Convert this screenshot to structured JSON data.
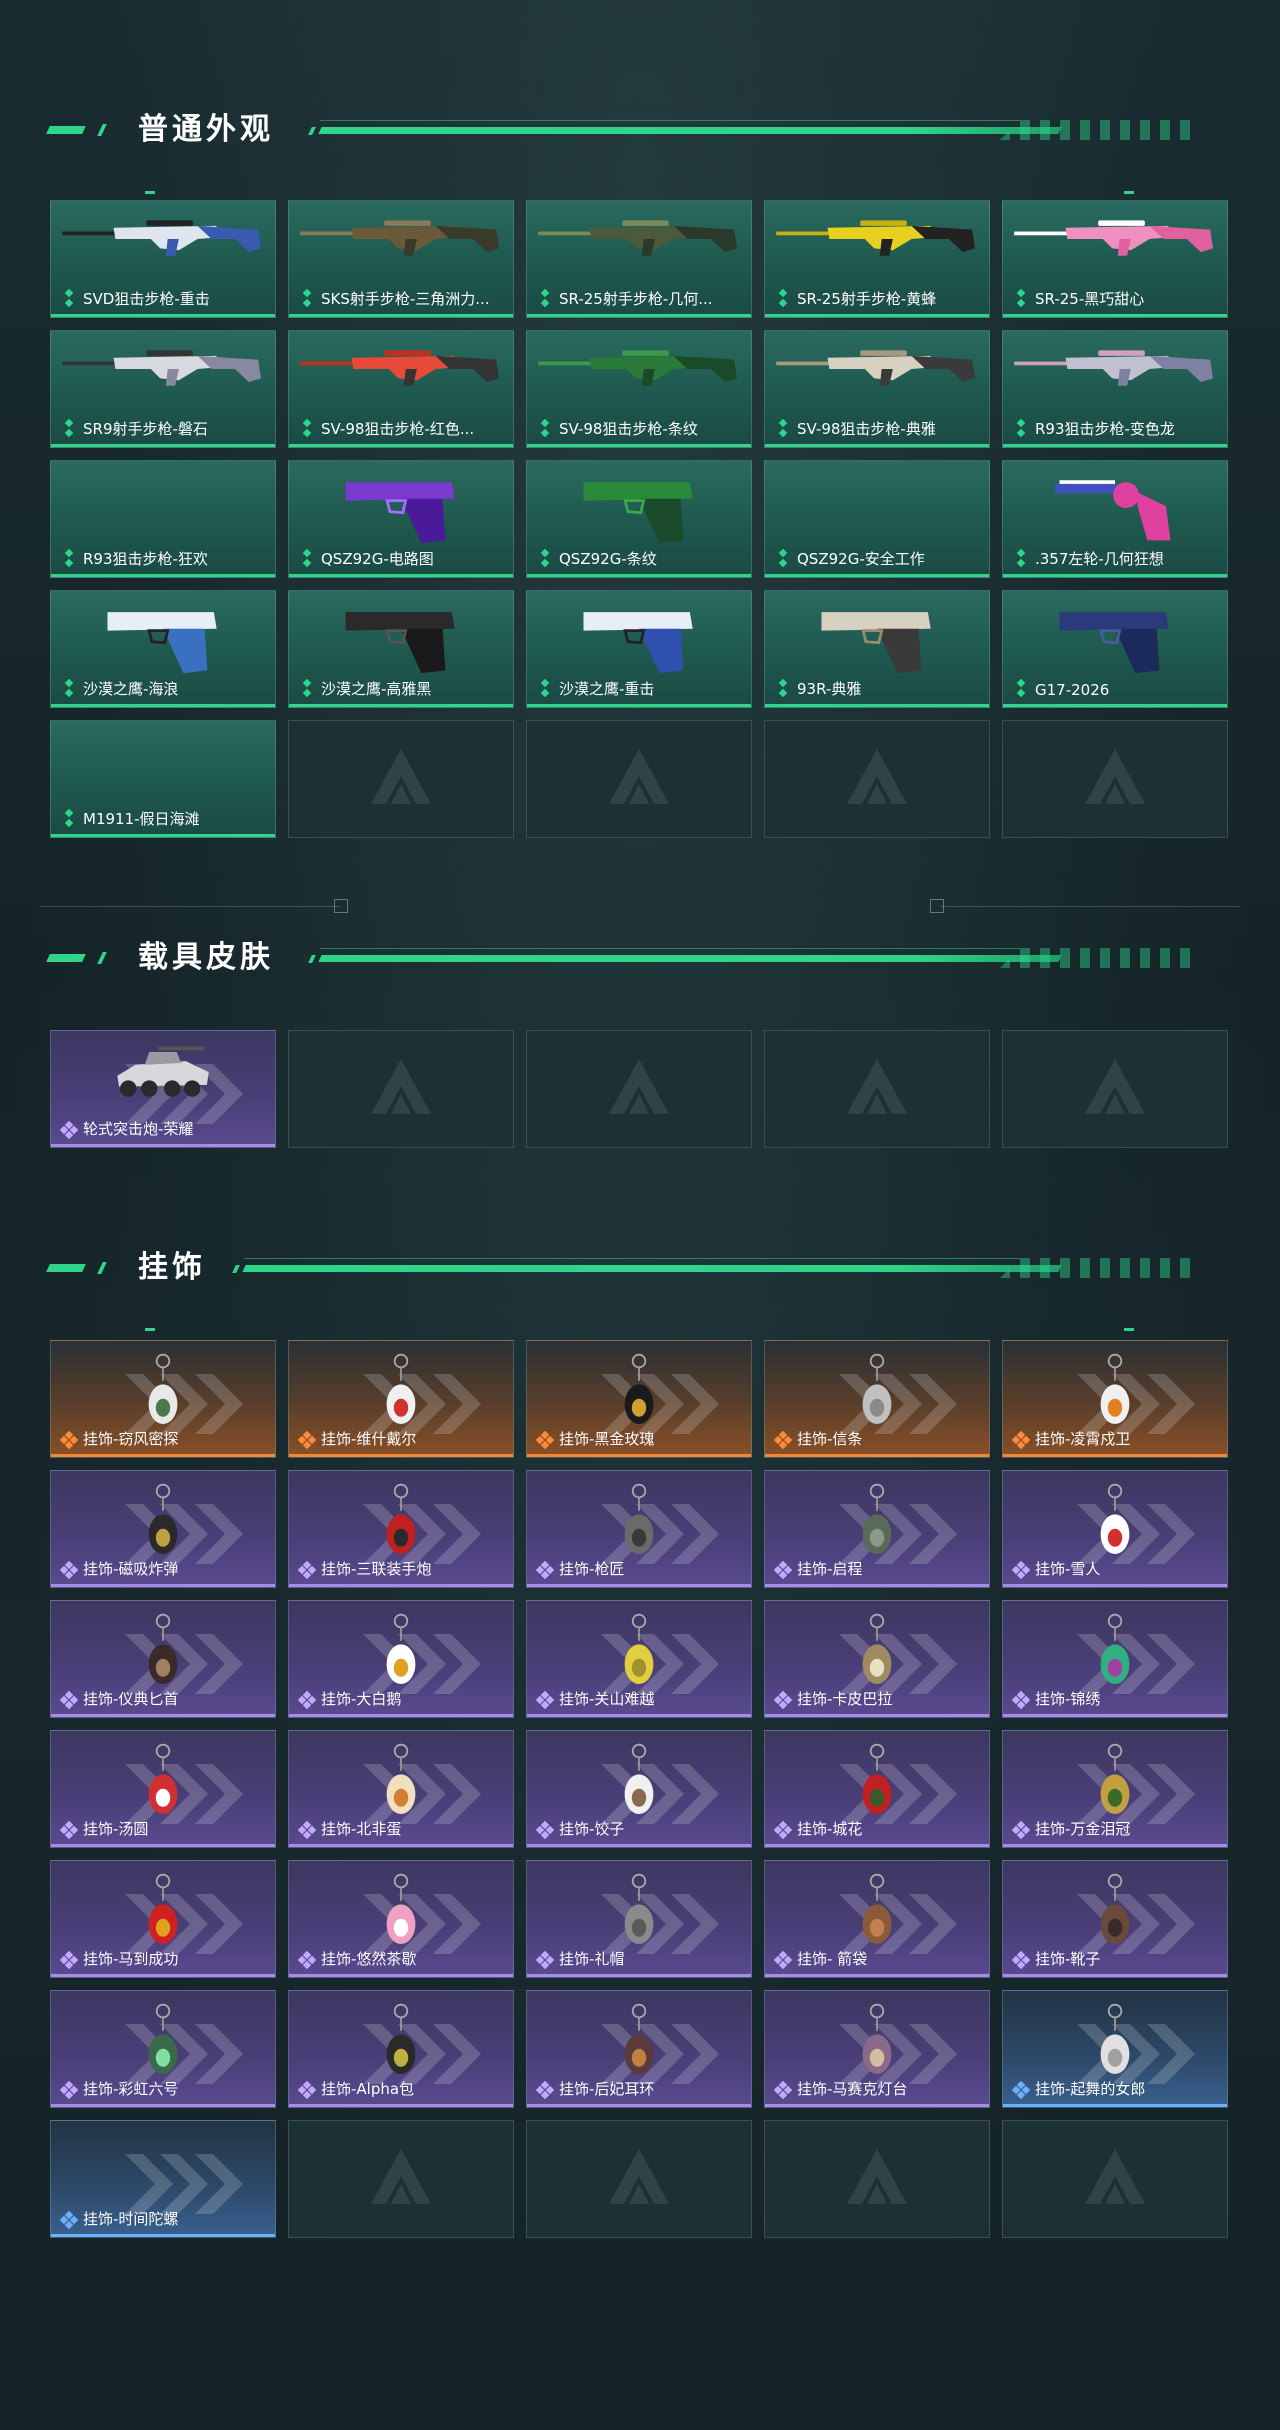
{
  "sections": {
    "appearance": {
      "title": "普通外观",
      "items": [
        {
          "label": "SVD狙击步枪-重击",
          "kind": "rifle",
          "colors": [
            "#dfe4ee",
            "#3a5ab0",
            "#222"
          ]
        },
        {
          "label": "SKS射手步枪-三角洲力...",
          "kind": "rifle",
          "colors": [
            "#6a5a3a",
            "#3a3a2a",
            "#8a7a5a"
          ]
        },
        {
          "label": "SR-25射手步枪-几何...",
          "kind": "rifle",
          "colors": [
            "#4a5a3a",
            "#2a3a2a",
            "#7a8a5a"
          ]
        },
        {
          "label": "SR-25射手步枪-黄蜂",
          "kind": "rifle",
          "colors": [
            "#e8d020",
            "#222",
            "#c8b010"
          ]
        },
        {
          "label": "SR-25-黑巧甜心",
          "kind": "rifle",
          "colors": [
            "#f090c0",
            "#e060a0",
            "#fff"
          ]
        },
        {
          "label": "SR9射手步枪-磐石",
          "kind": "rifle",
          "colors": [
            "#d8d8e0",
            "#8888a0",
            "#333"
          ]
        },
        {
          "label": "SV-98狙击步枪-红色...",
          "kind": "rifle",
          "colors": [
            "#e84a3a",
            "#333",
            "#c03020"
          ]
        },
        {
          "label": "SV-98狙击步枪-条纹",
          "kind": "rifle",
          "colors": [
            "#2a7a3a",
            "#1a4a2a",
            "#3a9a4a"
          ]
        },
        {
          "label": "SV-98狙击步枪-典雅",
          "kind": "rifle",
          "colors": [
            "#d8d0c0",
            "#3a3a3a",
            "#a89a80"
          ]
        },
        {
          "label": "R93狙击步枪-变色龙",
          "kind": "rifle",
          "colors": [
            "#c0c0d0",
            "#8080a0",
            "#d0a0c0"
          ]
        },
        {
          "label": "R93狙击步枪-狂欢",
          "kind": "none",
          "colors": []
        },
        {
          "label": "QSZ92G-电路图",
          "kind": "pistol",
          "colors": [
            "#7a3ad0",
            "#4a1a9a",
            "#a070ff"
          ]
        },
        {
          "label": "QSZ92G-条纹",
          "kind": "pistol",
          "colors": [
            "#2a8a3a",
            "#1a4a2a",
            "#3aaa4a"
          ]
        },
        {
          "label": "QSZ92G-安全工作",
          "kind": "none",
          "colors": []
        },
        {
          "label": ".357左轮-几何狂想",
          "kind": "revolver",
          "colors": [
            "#4050c0",
            "#e040a0",
            "#fff"
          ]
        },
        {
          "label": "沙漠之鹰-海浪",
          "kind": "pistol",
          "colors": [
            "#e8eef8",
            "#3a70c0",
            "#222"
          ]
        },
        {
          "label": "沙漠之鹰-高雅黑",
          "kind": "pistol",
          "colors": [
            "#2a2a2a",
            "#1a1a1a",
            "#555"
          ]
        },
        {
          "label": "沙漠之鹰-重击",
          "kind": "pistol",
          "colors": [
            "#e8eef8",
            "#3050b0",
            "#222"
          ]
        },
        {
          "label": "93R-典雅",
          "kind": "pistol",
          "colors": [
            "#d8d0c0",
            "#3a3a3a",
            "#9a8a70"
          ]
        },
        {
          "label": "G17-2026",
          "kind": "pistol",
          "colors": [
            "#2a3a7a",
            "#1a2a5a",
            "#4a5aa0"
          ]
        },
        {
          "label": "M1911-假日海滩",
          "kind": "none",
          "colors": []
        }
      ]
    },
    "vehicle": {
      "title": "载具皮肤",
      "items": [
        {
          "label": "轮式突击炮-荣耀",
          "kind": "vehicle"
        }
      ]
    },
    "charms": {
      "title": "挂饰",
      "items": [
        {
          "label": "挂饰-窃风密探",
          "rarity": "orange",
          "colors": [
            "#e8e8e8",
            "#4a7a4a"
          ]
        },
        {
          "label": "挂饰-维什戴尔",
          "rarity": "orange",
          "colors": [
            "#f0f0f0",
            "#d03030"
          ]
        },
        {
          "label": "挂饰-黑金玫瑰",
          "rarity": "orange",
          "colors": [
            "#1a1a1a",
            "#d0a030"
          ]
        },
        {
          "label": "挂饰-信条",
          "rarity": "orange",
          "colors": [
            "#c0c0c0",
            "#8a8a8a"
          ]
        },
        {
          "label": "挂饰-凌霄戍卫",
          "rarity": "orange",
          "colors": [
            "#f0f0f0",
            "#e08020"
          ]
        },
        {
          "label": "挂饰-磁吸炸弹",
          "rarity": "purple",
          "colors": [
            "#2a2a2a",
            "#c0a040"
          ]
        },
        {
          "label": "挂饰-三联装手炮",
          "rarity": "purple",
          "colors": [
            "#c02020",
            "#2a2a2a"
          ]
        },
        {
          "label": "挂饰-枪匠",
          "rarity": "purple",
          "colors": [
            "#6a6a6a",
            "#3a3a3a"
          ]
        },
        {
          "label": "挂饰-启程",
          "rarity": "purple",
          "colors": [
            "#5a6a5a",
            "#8a9a8a"
          ]
        },
        {
          "label": "挂饰-雪人",
          "rarity": "purple",
          "colors": [
            "#ffffff",
            "#d03030"
          ]
        },
        {
          "label": "挂饰-仪典匕首",
          "rarity": "purple",
          "colors": [
            "#3a2a2a",
            "#a08060"
          ]
        },
        {
          "label": "挂饰-大白鹅",
          "rarity": "purple",
          "colors": [
            "#ffffff",
            "#e0a020"
          ]
        },
        {
          "label": "挂饰-关山难越",
          "rarity": "purple",
          "colors": [
            "#e0d040",
            "#a09030"
          ]
        },
        {
          "label": "挂饰-卡皮巴拉",
          "rarity": "purple",
          "colors": [
            "#a08a60",
            "#e8e0c0"
          ]
        },
        {
          "label": "挂饰-锦绣",
          "rarity": "purple",
          "colors": [
            "#30b080",
            "#a040a0"
          ]
        },
        {
          "label": "挂饰-汤圆",
          "rarity": "purple",
          "colors": [
            "#d03030",
            "#ffffff"
          ]
        },
        {
          "label": "挂饰-北非蛋",
          "rarity": "purple",
          "colors": [
            "#f0e0c0",
            "#d08030"
          ]
        },
        {
          "label": "挂饰-饺子",
          "rarity": "purple",
          "colors": [
            "#f0f0f0",
            "#8a6a4a"
          ]
        },
        {
          "label": "挂饰-城花",
          "rarity": "purple",
          "colors": [
            "#c02020",
            "#3a5a2a"
          ]
        },
        {
          "label": "挂饰-万金泪冠",
          "rarity": "purple",
          "colors": [
            "#c0a040",
            "#3a6a2a"
          ]
        },
        {
          "label": "挂饰-马到成功",
          "rarity": "purple",
          "colors": [
            "#d02020",
            "#e0a020"
          ]
        },
        {
          "label": "挂饰-悠然茶歇",
          "rarity": "purple",
          "colors": [
            "#f0a0c0",
            "#ffffff"
          ]
        },
        {
          "label": "挂饰-礼帽",
          "rarity": "purple",
          "colors": [
            "#8a8a8a",
            "#5a5a5a"
          ]
        },
        {
          "label": "挂饰- 箭袋",
          "rarity": "purple",
          "colors": [
            "#8a5a3a",
            "#c08050"
          ]
        },
        {
          "label": "挂饰-靴子",
          "rarity": "purple",
          "colors": [
            "#6a4a3a",
            "#3a2a2a"
          ]
        },
        {
          "label": "挂饰-彩虹六号",
          "rarity": "purple",
          "colors": [
            "#3a6a4a",
            "#80e0a0"
          ]
        },
        {
          "label": "挂饰-Alpha包",
          "rarity": "purple",
          "colors": [
            "#2a2a2a",
            "#c0b040"
          ]
        },
        {
          "label": "挂饰-后妃耳环",
          "rarity": "purple",
          "colors": [
            "#5a3a3a",
            "#c08040"
          ]
        },
        {
          "label": "挂饰-马赛克灯台",
          "rarity": "purple",
          "colors": [
            "#8a6a8a",
            "#d0c0a0"
          ]
        },
        {
          "label": "挂饰-起舞的女郎",
          "rarity": "blue",
          "colors": [
            "#e0e0e0",
            "#a0a0a0"
          ]
        },
        {
          "label": "挂饰-时间陀螺",
          "rarity": "blue",
          "colors": []
        }
      ]
    }
  },
  "empty_slot_icon": "logo-watermark-icon",
  "accent_color": "#2ed58a"
}
